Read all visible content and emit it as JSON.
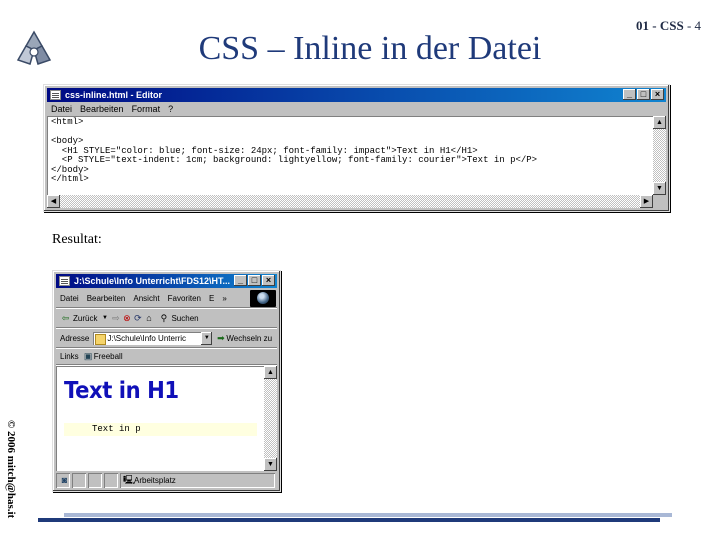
{
  "slide": {
    "title": "CSS – Inline in der Datei",
    "number_prefix": "01 - CSS",
    "number_suffix": "- 4",
    "result_label": "Resultat:",
    "copyright": "© 2006 mitch@has.it"
  },
  "editor": {
    "window_title": "css-inline.html - Editor",
    "menu": [
      "Datei",
      "Bearbeiten",
      "Format",
      "?"
    ],
    "lines": [
      "<html>",
      "",
      "<body>",
      "  <H1 STYLE=\"color: blue; font-size: 24px; font-family: impact\">Text in H1</H1>",
      "  <P STYLE=\"text-indent: 1cm; background: lightyellow; font-family: courier\">Text in p</P>",
      "</body>",
      "</html>"
    ]
  },
  "browser": {
    "window_title": "J:\\Schule\\Info Unterricht\\FDS12\\HT...",
    "menu": [
      "Datei",
      "Bearbeiten",
      "Ansicht",
      "Favoriten",
      "E",
      "»"
    ],
    "toolbar": {
      "back_label": "Zurück",
      "search_label": "Suchen"
    },
    "address_label": "Adresse",
    "address_value": "J:\\Schule\\Info Unterric",
    "go_label": "Wechseln zu",
    "links_label": "Links",
    "links_item": "Freeball",
    "page": {
      "h1": "Text in H1",
      "p": "Text in p"
    },
    "status_zone": "Arbeitsplatz"
  },
  "colors": {
    "title_blue": "#1f3a7a",
    "h1_blue": "#1010b8",
    "p_background": "#ffffe0",
    "titlebar_start": "#000a84",
    "titlebar_end": "#1084d0"
  }
}
